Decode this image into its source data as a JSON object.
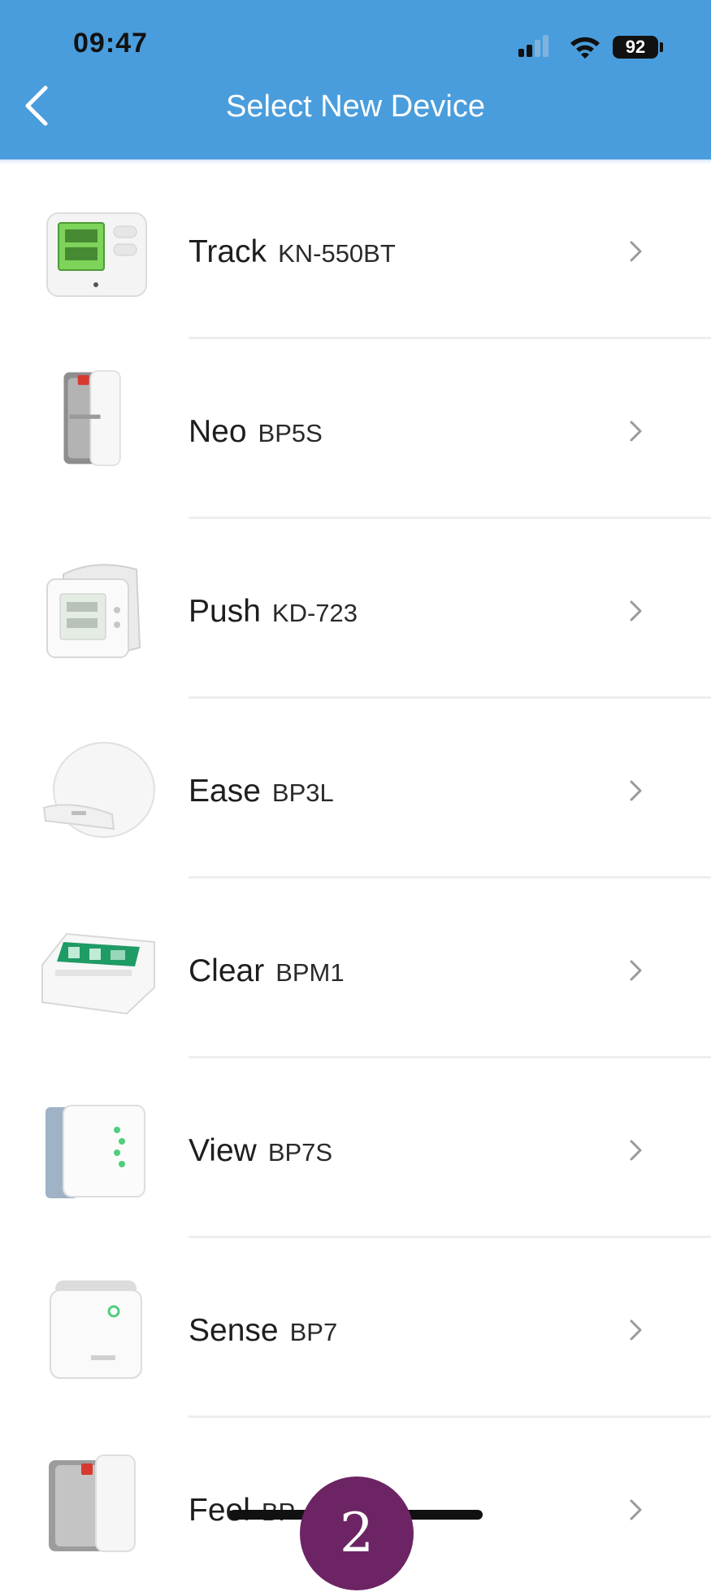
{
  "status_bar": {
    "time": "09:47",
    "battery": "92"
  },
  "header": {
    "title": "Select New Device"
  },
  "devices": [
    {
      "name": "Track",
      "model": "KN-550BT"
    },
    {
      "name": "Neo",
      "model": "BP5S"
    },
    {
      "name": "Push",
      "model": "KD-723"
    },
    {
      "name": "Ease",
      "model": "BP3L"
    },
    {
      "name": "Clear",
      "model": "BPM1"
    },
    {
      "name": "View",
      "model": "BP7S"
    },
    {
      "name": "Sense",
      "model": "BP7"
    },
    {
      "name": "Feel",
      "model": "BP"
    }
  ],
  "overlay": {
    "page_number": "2"
  },
  "colors": {
    "header": "#4a9ddc",
    "badge": "#6d2464",
    "track_screen": "#7ed35a",
    "clear_screen": "#1f9b66"
  }
}
